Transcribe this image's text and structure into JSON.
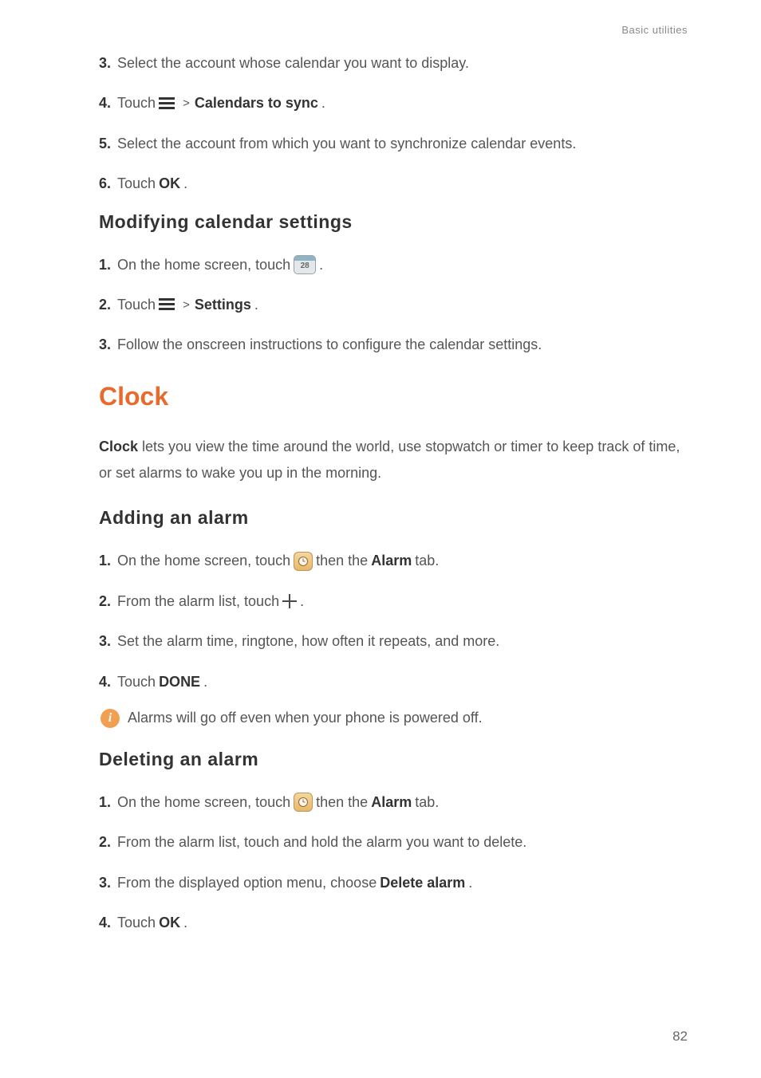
{
  "header": {
    "section_label": "Basic utilities"
  },
  "steps_top": {
    "s3": {
      "num": "3.",
      "text": "Select the account whose calendar you want to display."
    },
    "s4": {
      "num": "4.",
      "prefix": "Touch",
      "bold": "Calendars to sync",
      "suffix": "."
    },
    "s5": {
      "num": "5.",
      "text": "Select the account from which you want to synchronize calendar events."
    },
    "s6": {
      "num": "6.",
      "prefix": "Touch",
      "bold": "OK",
      "suffix": "."
    }
  },
  "modifying": {
    "title": "Modifying  calendar  settings",
    "s1": {
      "num": "1.",
      "prefix": "On the home screen, touch",
      "icon_day": "28",
      "suffix": "."
    },
    "s2": {
      "num": "2.",
      "prefix": "Touch",
      "bold": "Settings",
      "suffix": "."
    },
    "s3": {
      "num": "3.",
      "text": "Follow the onscreen instructions to configure the calendar settings."
    }
  },
  "clock": {
    "title": "Clock",
    "intro_bold": "Clock",
    "intro_rest": " lets you view the time around the world, use stopwatch or timer to keep track of time, or set alarms to wake you up in the morning."
  },
  "adding": {
    "title": "Adding  an  alarm",
    "s1": {
      "num": "1.",
      "prefix": "On the home screen, touch",
      "mid": "then the",
      "bold": "Alarm",
      "suffix": " tab."
    },
    "s2": {
      "num": "2.",
      "prefix": "From the alarm list, touch",
      "suffix": "."
    },
    "s3": {
      "num": "3.",
      "text": "Set the alarm time, ringtone, how often it repeats, and more."
    },
    "s4": {
      "num": "4.",
      "prefix": "Touch",
      "bold": "DONE",
      "suffix": "."
    },
    "note": "Alarms will go off even when your phone is powered off."
  },
  "deleting": {
    "title": "Deleting  an  alarm",
    "s1": {
      "num": "1.",
      "prefix": "On the home screen, touch",
      "mid": "then the",
      "bold": "Alarm",
      "suffix": " tab."
    },
    "s2": {
      "num": "2.",
      "text": "From the alarm list, touch and hold the alarm you want to delete."
    },
    "s3": {
      "num": "3.",
      "prefix": "From the displayed option menu, choose",
      "bold": "Delete alarm",
      "suffix": "."
    },
    "s4": {
      "num": "4.",
      "prefix": "Touch",
      "bold": "OK",
      "suffix": "."
    }
  },
  "page_number": "82",
  "info_glyph": "i",
  "gt_symbol": ">"
}
